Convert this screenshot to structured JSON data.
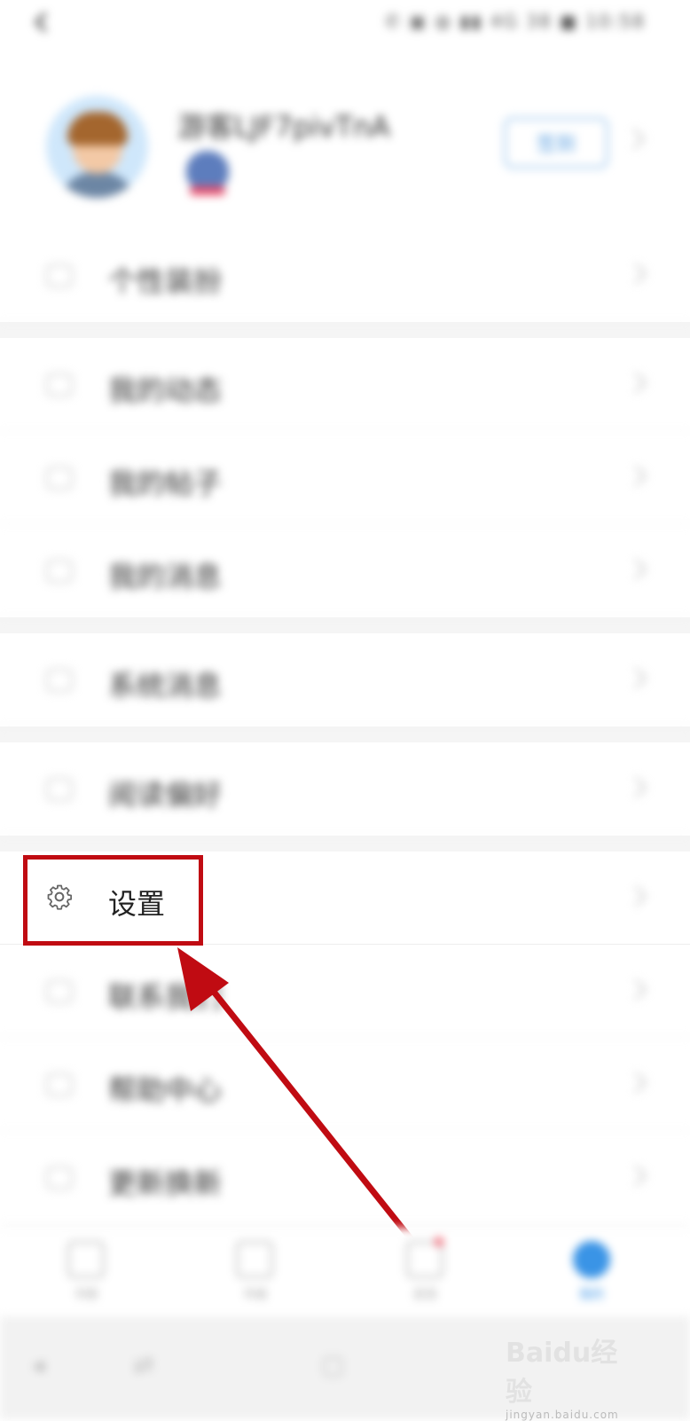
{
  "status_bar": {
    "icons_text": "✆ ▣ ◍ ▮▮ 4G 38 ■ 10:58"
  },
  "profile": {
    "username": "游客LJF7pivTnA",
    "sign_button": "签到"
  },
  "menu": {
    "items": [
      {
        "label": "个性装扮",
        "icon": "personalize-icon"
      },
      {
        "label": "我的动态",
        "icon": "feed-icon"
      },
      {
        "label": "我的帖子",
        "icon": "post-icon"
      },
      {
        "label": "我的消息",
        "icon": "message-icon"
      },
      {
        "label": "系统消息",
        "icon": "system-message-icon"
      },
      {
        "label": "阅读偏好",
        "icon": "reading-preference-icon"
      },
      {
        "label": "设置",
        "icon": "gear-icon"
      },
      {
        "label": "联系我们",
        "icon": "contact-icon"
      },
      {
        "label": "帮助中心",
        "icon": "help-icon"
      },
      {
        "label": "更新换新",
        "icon": "update-icon"
      }
    ]
  },
  "tabbar": {
    "tabs": [
      {
        "label": "书架"
      },
      {
        "label": "书城"
      },
      {
        "label": "发现"
      },
      {
        "label": "我的"
      }
    ]
  },
  "watermark": {
    "brand": "Baidu经验",
    "url": "jingyan.baidu.com"
  },
  "colors": {
    "highlight": "#c00b12",
    "accent": "#3a94e6"
  }
}
